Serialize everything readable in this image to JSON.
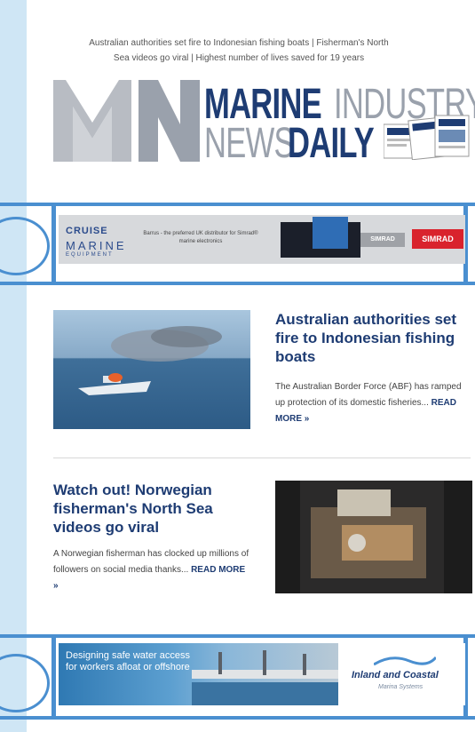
{
  "preheader": {
    "line1": "Australian authorities set fire to Indonesian fishing boats | Fisherman's North",
    "line2": "Sea videos go viral | Highest number of lives saved for 19 years"
  },
  "logo": {
    "w1": "MARINE",
    "w2": "INDUSTRY",
    "w3": "NEWS",
    "w4": "DAILY"
  },
  "ad1": {
    "brand1": "CRUISE",
    "brand2": "MARINE",
    "brand3": "EQUIPMENT",
    "text": "Barrus - the preferred UK distributor for Simrad® marine electronics",
    "grey_label": "SIMRAD",
    "logo": "SIMRAD"
  },
  "articles": [
    {
      "title": "Australian authorities set fire to Indonesian fishing boats",
      "desc": "The Australian Border Force (ABF) has ramped up protection of its domestic fisheries...",
      "more": "READ MORE »"
    },
    {
      "title": "Watch out! Norwegian fisherman's North Sea videos go viral",
      "desc": "A Norwegian fisherman has clocked up millions of followers on social media thanks...",
      "more": "READ MORE »"
    }
  ],
  "ad2": {
    "text": "Designing safe water access for workers afloat or offshore",
    "logo": "Inland and Coastal",
    "sub": "Marina Systems"
  },
  "colors": {
    "brand_navy": "#1e3c73",
    "background": "#cfe6f5",
    "frame_blue": "#4a8fd0"
  }
}
